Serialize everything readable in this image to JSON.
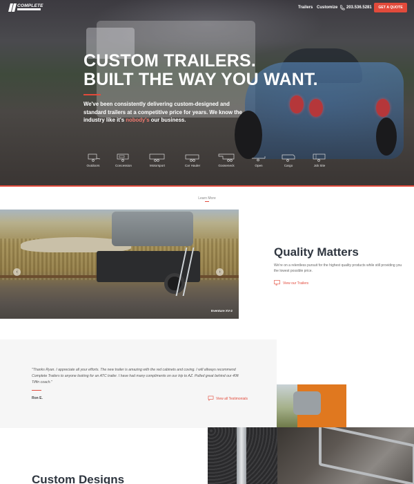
{
  "nav": {
    "logo_text": "COMPLETE",
    "links": [
      "Trailers",
      "Customize"
    ],
    "phone": "203.536.5281",
    "cta": "GET A QUOTE"
  },
  "hero": {
    "title_line1": "CUSTOM TRAILERS.",
    "title_line2": "BUILT THE WAY YOU WANT.",
    "subtitle_before": "We've been consistently delivering custom-designed and standard trailers at a competitive price for years. We know the industry like it's ",
    "subtitle_highlight": "nobody's",
    "subtitle_after": " our business.",
    "categories": [
      "Outdoors",
      "Concession",
      "Motorsport",
      "Car Hauler",
      "Gooseneck",
      "Open",
      "Cargo",
      "Job Site"
    ]
  },
  "learn_more": "Learn More",
  "featured": {
    "caption": "Eventure XV-2",
    "title": "Quality Matters",
    "text": "We're on a relentless pursuit for the highest quality products while still providing you the lowest possible price.",
    "link": "View our Trailers"
  },
  "testimonial": {
    "quote": "\"Thanks Ryan. I appreciate all your efforts. The new trailer is amazing with the red cabinets and coving. I will allways recommend Complete Trailers to anyone looking for an ATC trailer. I have had many compliments on our trip to AZ. Pulled great behind our 40ft Tiffin coach.\"",
    "author": "Ron E.",
    "link": "View all Testimonials"
  },
  "custom": {
    "title": "Custom Designs"
  },
  "colors": {
    "accent": "#e24a3b",
    "heading": "#2f3640"
  }
}
